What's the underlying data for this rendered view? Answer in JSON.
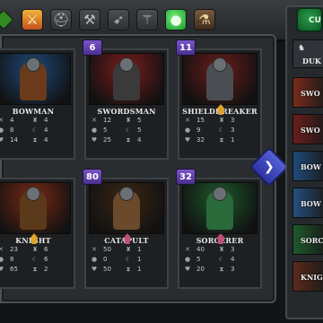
{
  "tabs": [
    {
      "icon": "diamond-icon"
    },
    {
      "icon": "crossed-swords-icon",
      "glyph": "⚔"
    },
    {
      "icon": "helmet-icon",
      "glyph": "⛑"
    },
    {
      "icon": "hammer-icon",
      "glyph": "⚒"
    },
    {
      "icon": "crossbow-icon",
      "glyph": "➶"
    },
    {
      "icon": "staff-icon",
      "glyph": "⚚"
    },
    {
      "icon": "green-orb-icon",
      "glyph": "●"
    },
    {
      "icon": "potion-icon",
      "glyph": "⚗"
    }
  ],
  "units": [
    {
      "name": "BOWMAN",
      "level": "",
      "stats": [
        [
          "✕",
          "4",
          "♜",
          "4"
        ],
        [
          "●",
          "8",
          "☾",
          "4"
        ],
        [
          "♥",
          "14",
          "⧗",
          "4"
        ]
      ],
      "colors": [
        "#1e4a7a",
        "#6a3a1a"
      ],
      "star": ""
    },
    {
      "name": "SWORDSMAN",
      "level": "6",
      "stats": [
        [
          "✕",
          "12",
          "♜",
          "5"
        ],
        [
          "●",
          "5",
          "☾",
          "5"
        ],
        [
          "♥",
          "25",
          "⧗",
          "4"
        ]
      ],
      "colors": [
        "#7a1c1c",
        "#3a3a3a"
      ],
      "star": ""
    },
    {
      "name": "SHIELDBREAKER",
      "level": "11",
      "stats": [
        [
          "✕",
          "15",
          "♜",
          "3"
        ],
        [
          "●",
          "9",
          "☾",
          "3"
        ],
        [
          "♥",
          "32",
          "⧗",
          "1"
        ]
      ],
      "colors": [
        "#6a1c1a",
        "#4a4e52"
      ],
      "star": "gold"
    },
    {
      "name": "KNIGHT",
      "level": "",
      "stats": [
        [
          "✕",
          "23",
          "♜",
          "6"
        ],
        [
          "●",
          "8",
          "☾",
          "6"
        ],
        [
          "♥",
          "65",
          "⧗",
          "2"
        ]
      ],
      "colors": [
        "#7a2a14",
        "#5a3a1a"
      ],
      "star": "gold"
    },
    {
      "name": "CATAPULT",
      "level": "80",
      "stats": [
        [
          "✕",
          "50",
          "♜",
          "1"
        ],
        [
          "●",
          "0",
          "☾",
          "1"
        ],
        [
          "♥",
          "50",
          "⧗",
          "1"
        ]
      ],
      "colors": [
        "#3a2614",
        "#6a4a2a"
      ],
      "star": "pink"
    },
    {
      "name": "SORCERER",
      "level": "32",
      "stats": [
        [
          "✕",
          "40",
          "♜",
          "3"
        ],
        [
          "●",
          "5",
          "☾",
          "4"
        ],
        [
          "♥",
          "20",
          "⧗",
          "3"
        ]
      ],
      "colors": [
        "#1c5a2a",
        "#2a6a3a"
      ],
      "star": "pink"
    }
  ],
  "next_button": "❯",
  "side": {
    "tab_label": "CU",
    "header": {
      "icon": "helmet-icon",
      "glyph": "♞",
      "label": "DUK"
    },
    "items": [
      {
        "label": "SWO",
        "color": "#7a2a1a"
      },
      {
        "label": "SWO",
        "color": "#6a1c1a"
      },
      {
        "label": "BOW",
        "color": "#1e4a7a"
      },
      {
        "label": "BOW",
        "color": "#24507e"
      },
      {
        "label": "SORC",
        "color": "#1c5a2a"
      },
      {
        "label": "KNIG",
        "color": "#5a2a1a"
      }
    ]
  }
}
